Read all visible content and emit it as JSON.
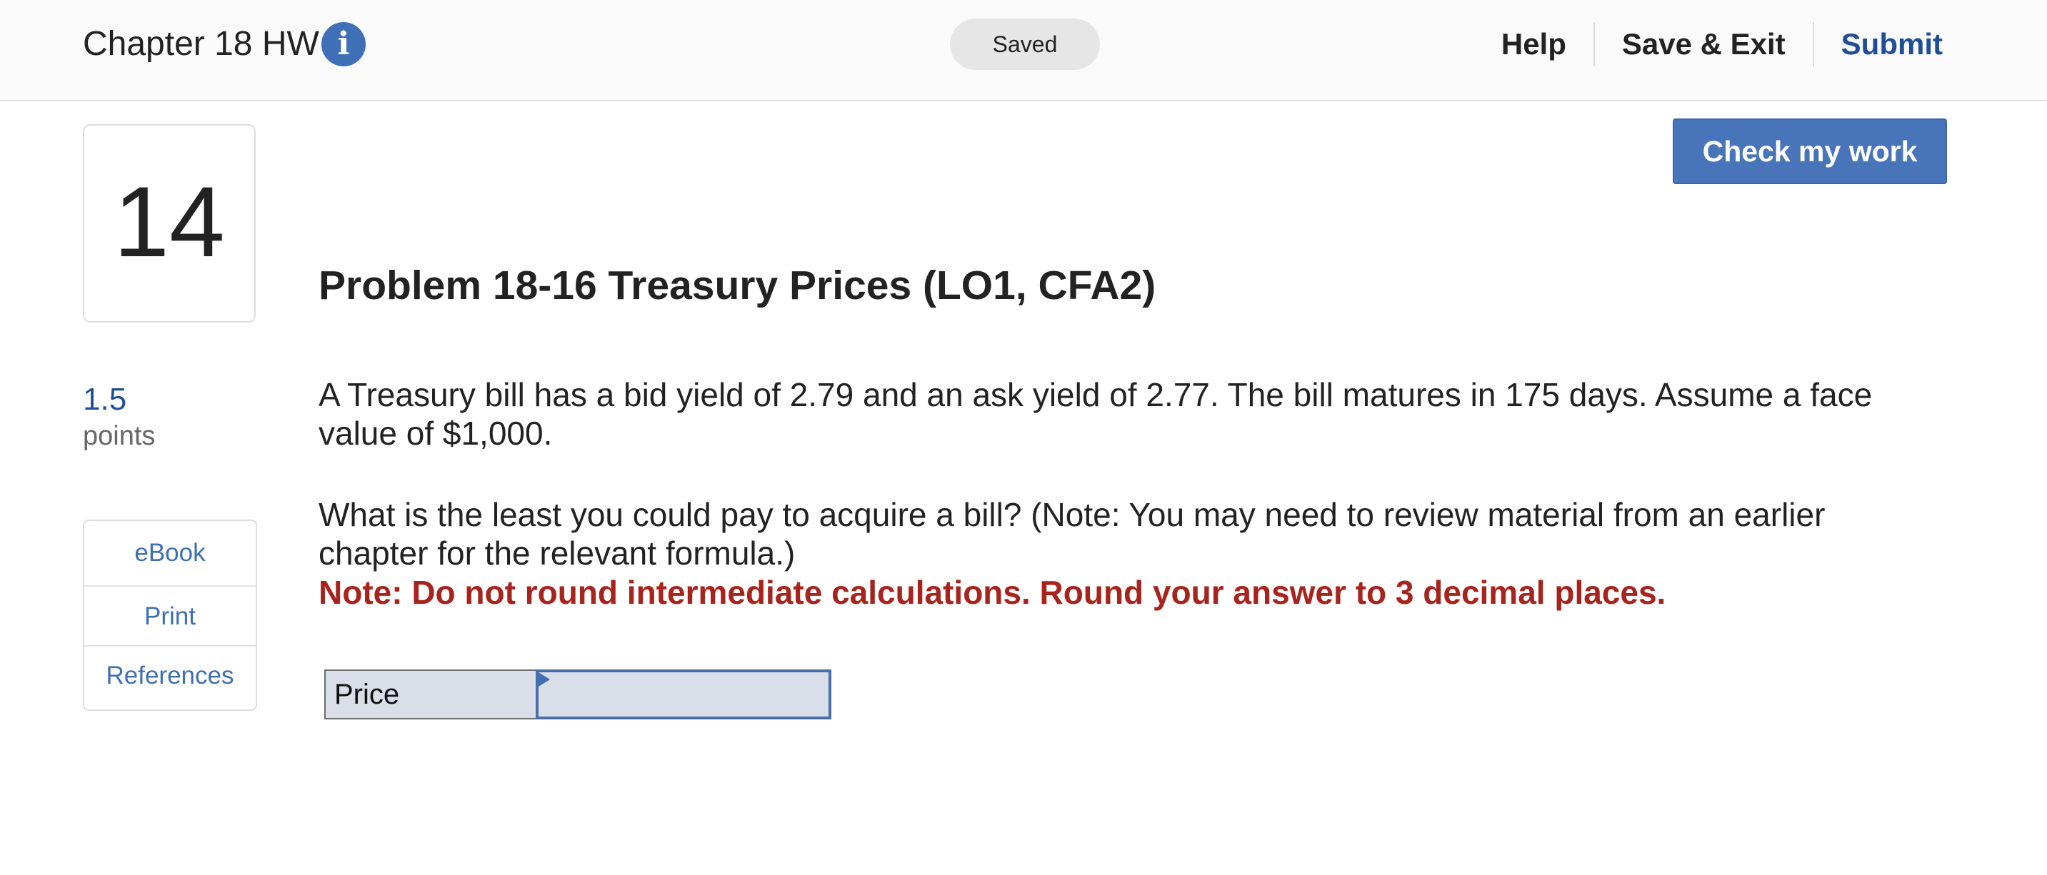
{
  "header": {
    "assignment_title": "Chapter 18 HW",
    "info_icon": "info-icon",
    "info_glyph": "i",
    "status": "Saved",
    "nav": {
      "help": "Help",
      "save_exit": "Save & Exit",
      "submit": "Submit"
    }
  },
  "question": {
    "number": "14",
    "points_value": "1.5",
    "points_label": "points",
    "resources": [
      "eBook",
      "Print",
      "References"
    ],
    "check_button": "Check my work",
    "title": "Problem 18-16 Treasury Prices (LO1, CFA2)",
    "paragraphs": [
      "A Treasury bill has a bid yield of 2.79 and an ask yield of 2.77. The bill matures in 175 days. Assume a face value of $1,000.",
      "What is the least you could pay to acquire a bill? (Note: You may need to review material from an earlier chapter for the relevant formula.)"
    ],
    "note": "Note: Do not round intermediate calculations. Round your answer to 3 decimal places.",
    "answer_table": {
      "label": "Price",
      "value": ""
    }
  },
  "colors": {
    "accent_blue": "#4874ba",
    "link_blue": "#3e6fb4",
    "submit_blue": "#1f4e96",
    "note_red": "#a8231c",
    "cell_fill": "#d9dee8"
  }
}
